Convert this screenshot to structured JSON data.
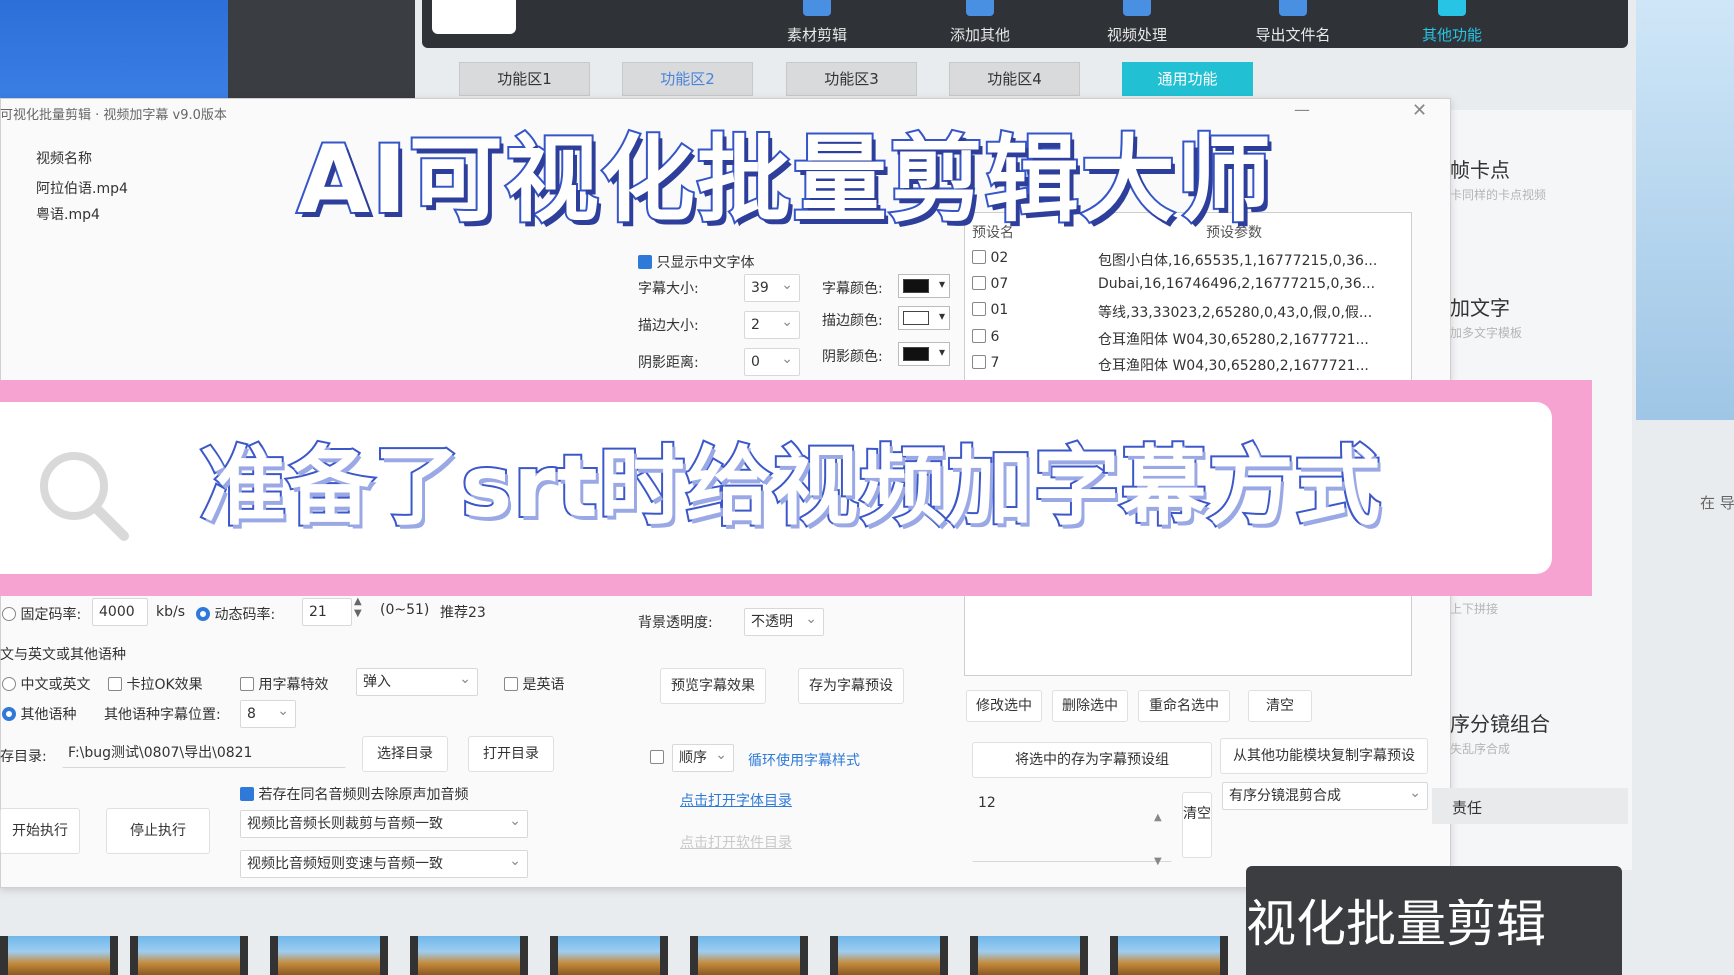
{
  "toolbar": {
    "items": [
      {
        "label": "素材剪辑",
        "icon": "scissors-icon"
      },
      {
        "label": "添加其他",
        "icon": "add-icon"
      },
      {
        "label": "视频处理",
        "icon": "video-icon"
      },
      {
        "label": "导出文件名",
        "icon": "export-icon"
      },
      {
        "label": "其他功能",
        "icon": "more-icon"
      }
    ]
  },
  "tabs": [
    {
      "label": "功能区1"
    },
    {
      "label": "功能区2"
    },
    {
      "label": "功能区3"
    },
    {
      "label": "功能区4"
    },
    {
      "label": "通用功能"
    }
  ],
  "window": {
    "title": "可视化批量剪辑 · 视频加字幕 v9.0版本",
    "min": "—",
    "close": "✕"
  },
  "file_list": {
    "header": "视频名称",
    "items": [
      "阿拉伯语.mp4",
      "粤语.mp4"
    ]
  },
  "font_panel": {
    "only_chinese": "只显示中文字体",
    "size_label": "字幕大小:",
    "size_value": "39",
    "stroke_label": "描边大小:",
    "stroke_value": "2",
    "shadow_label": "阴影距离:",
    "shadow_value": "0",
    "color_label": "字幕颜色:",
    "stroke_color_label": "描边颜色:",
    "shadow_color_label": "阴影颜色:"
  },
  "preset_list": {
    "col1": "预设名",
    "col2": "预设参数",
    "rows": [
      {
        "name": "02",
        "value": "包图小白体,16,65535,1,16777215,0,36..."
      },
      {
        "name": "07",
        "value": "Dubai,16,16746496,2,16777215,0,36..."
      },
      {
        "name": "01",
        "value": "等线,33,33023,2,65280,0,43,0,假,0,假..."
      },
      {
        "name": "6",
        "value": "仓耳渔阳体 W04,30,65280,2,1677721..."
      },
      {
        "name": "7",
        "value": "仓耳渔阳体 W04,30,65280,2,1677721..."
      }
    ]
  },
  "headline": "AI可视化批量剪辑大师",
  "subline": "准备了srt时给视频加字幕方式",
  "bitrate": {
    "fixed_label": "固定码率:",
    "fixed_value": "4000",
    "fixed_unit": "kb/s",
    "dynamic_label": "动态码率:",
    "dynamic_value": "21",
    "range": "(0~51)",
    "recommend": "推荐23"
  },
  "language": {
    "section": "文与英文或其他语种",
    "cn_en": "中文或英文",
    "karaoke": "卡拉OK效果",
    "effect": "用字幕特效",
    "effect_value": "弹入",
    "is_english": "是英语",
    "other": "其他语种",
    "position_label": "其他语种字幕位置:",
    "position_value": "8"
  },
  "output": {
    "label": "存目录:",
    "path": "F:\\bug测试\\0807\\导出\\0821",
    "choose": "选择目录",
    "open": "打开目录"
  },
  "audio": {
    "remove_original": "若存在同名音频则去除原声加音频",
    "longer": "视频比音频长则裁剪与音频一致",
    "shorter": "视频比音频短则变速与音频一致"
  },
  "actions": {
    "start": "开始执行",
    "stop": "停止执行"
  },
  "style_panel": {
    "bg_opacity_label": "背景透明度:",
    "bg_opacity_value": "不透明",
    "preview": "预览字幕效果",
    "save_preset": "存为字幕预设",
    "order_value": "顺序",
    "cycle_style": "循环使用字幕样式",
    "open_font_dir": "点击打开字体目录",
    "open_soft_dir": "点击打开软件目录"
  },
  "preset_actions": {
    "modify": "修改选中",
    "delete": "删除选中",
    "rename": "重命名选中",
    "clear": "清空",
    "save_group": "将选中的存为字幕预设组",
    "copy_from": "从其他功能模块复制字幕预设",
    "number": "12",
    "clear_vertical": "清空",
    "mode": "有序分镜混剪合成"
  },
  "right_sidebar": {
    "item1_title": "帧卡点",
    "item1_sub": "卡同样的卡点视频",
    "item2_title": "加文字",
    "item2_sub": "加多文字模板",
    "item3_sub": "上下拼接",
    "item4_title": "序分镜组合",
    "item4_sub": "失乱序合成",
    "item5_title": "责任",
    "edge_text": "在 导"
  },
  "promo": {
    "text": "视化批量剪辑"
  }
}
